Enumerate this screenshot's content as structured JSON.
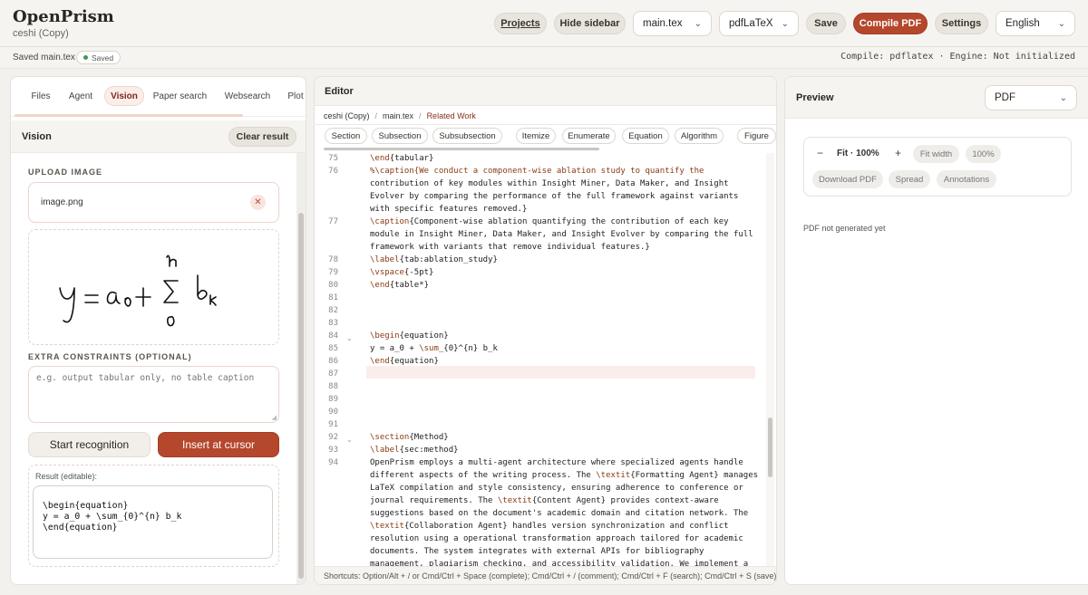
{
  "app": {
    "title": "OpenPrism",
    "subtitle": "ceshi (Copy)"
  },
  "topbar": {
    "projects": "Projects",
    "hide_sidebar": "Hide sidebar",
    "file_select": "main.tex",
    "engine_select": "pdfLaTeX",
    "save": "Save",
    "compile": "Compile PDF",
    "settings": "Settings",
    "language": "English",
    "colors": {
      "accent": "#b5472c"
    }
  },
  "status": {
    "saved_text": "Saved main.tex",
    "saved_badge": "Saved",
    "compile_info": "Compile: pdflatex · Engine: Not initialized"
  },
  "sidebar": {
    "tabs": [
      "Files",
      "Agent",
      "Vision",
      "Paper search",
      "Websearch",
      "Plot"
    ],
    "active_tab": "Vision",
    "section_title": "Vision",
    "clear_result": "Clear result",
    "upload_label": "UPLOAD IMAGE",
    "upload_file": "image.png",
    "extra_label": "EXTRA CONSTRAINTS (OPTIONAL)",
    "extra_placeholder": "e.g. output tabular only, no table caption",
    "start_recognition": "Start recognition",
    "insert_at_cursor": "Insert at cursor",
    "result_label": "Result (editable):",
    "result_text": "\\begin{equation}\ny = a_0 + \\sum_{0}^{n} b_k\n\\end{equation}"
  },
  "editor": {
    "title": "Editor",
    "breadcrumb": [
      "ceshi (Copy)",
      "main.tex",
      "Related Work"
    ],
    "insert_buttons": [
      "Section",
      "Subsection",
      "Subsubsection",
      "Itemize",
      "Enumerate",
      "Equation",
      "Algorithm",
      "Figure"
    ],
    "line_numbers": [
      "75",
      "76",
      "77",
      "78",
      "79",
      "80",
      "81",
      "82",
      "83",
      "84",
      "85",
      "86",
      "87",
      "88",
      "89",
      "90",
      "91",
      "92",
      "93",
      "94"
    ],
    "shortcuts": "Shortcuts: Option/Alt + / or Cmd/Ctrl + Space (complete); Cmd/Ctrl + / (comment); Cmd/Ctrl + F (search); Cmd/Ctrl + S (save)",
    "code": [
      "\\end{tabular}",
      "%\\caption{We conduct a component-wise ablation study to quantify the",
      "contribution of key modules within Insight Miner, Data Maker, and Insight",
      "Evolver by comparing the performance of the full framework against variants",
      "with specific features removed.}",
      "\\caption{Component-wise ablation quantifying the contribution of each key",
      "module in Insight Miner, Data Maker, and Insight Evolver by comparing the full",
      "framework with variants that remove individual features.}",
      "\\label{tab:ablation_study}",
      "\\vspace{-5pt}",
      "\\end{table*}",
      "\\begin{equation}",
      "y = a_0 + \\sum_{0}^{n} b_k",
      "\\end{equation}",
      "\\section{Method}",
      "\\label{sec:method}",
      "OpenPrism employs a multi-agent architecture where specialized agents handle",
      "different aspects of the writing process. The \\textit{Formatting Agent} manages",
      "LaTeX compilation and style consistency, ensuring adherence to conference or",
      "journal requirements. The \\textit{Content Agent} provides context-aware",
      "suggestions based on the document's academic domain and citation network. The",
      "\\textit{Collaboration Agent} handles version synchronization and conflict",
      "resolution using a operational transformation approach tailored for academic",
      "documents. The system integrates with external APIs for bibliography",
      "management, plagiarism checking, and accessibility validation. We implement a"
    ]
  },
  "preview": {
    "title": "Preview",
    "mode_select": "PDF",
    "zoom_minus": "−",
    "fit_label": "Fit · 100%",
    "zoom_plus": "+",
    "fit_width": "Fit width",
    "percent_100": "100%",
    "download": "Download PDF",
    "spread": "Spread",
    "annotations": "Annotations",
    "empty_text": "PDF not generated yet"
  }
}
